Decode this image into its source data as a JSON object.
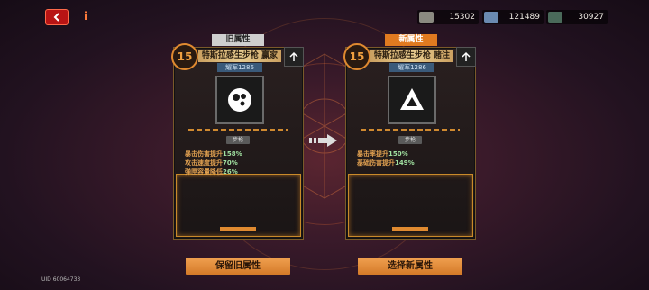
{
  "resources": [
    {
      "icon": "coin-stack-icon",
      "value": "15302"
    },
    {
      "icon": "crate-icon",
      "value": "121489"
    },
    {
      "icon": "crystal-icon",
      "value": "30927"
    }
  ],
  "old_panel": {
    "tag": "旧属性",
    "level": "15",
    "title": "特斯拉感生步枪 赢家",
    "sub": "耀军1286",
    "pill": "步枪",
    "stats": [
      {
        "label": "暴击伤害提升",
        "value": "158%"
      },
      {
        "label": "攻击速度提升",
        "value": "70%"
      },
      {
        "label": "弹匣容量降低",
        "value": "26%"
      }
    ]
  },
  "new_panel": {
    "tag": "新属性",
    "level": "15",
    "title": "特斯拉感生步枪 赌注",
    "sub": "耀军1286",
    "pill": "步枪",
    "stats": [
      {
        "label": "暴击率提升",
        "value": "150%"
      },
      {
        "label": "基础伤害提升",
        "value": "149%"
      }
    ]
  },
  "buttons": {
    "keep": "保留旧属性",
    "choose": "选择新属性"
  },
  "uid": "UID 60064733",
  "colors": {
    "accent": "#e08a30",
    "back": "#b81414",
    "new_tag": "#e07a20",
    "old_tag": "#cfcfcf"
  }
}
